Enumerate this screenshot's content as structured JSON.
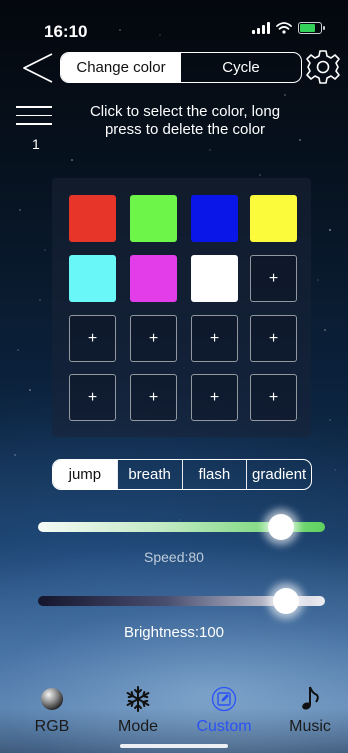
{
  "status": {
    "time": "16:10"
  },
  "header": {
    "tabs": [
      {
        "label": "Change color",
        "active": true
      },
      {
        "label": "Cycle",
        "active": false
      }
    ]
  },
  "list_count": "1",
  "hint": "Click to select the color, long press to delete the color",
  "grid": {
    "cells": [
      {
        "color": "#e8352a"
      },
      {
        "color": "#6df54a"
      },
      {
        "color": "#0a16e8"
      },
      {
        "color": "#fbfb3c"
      },
      {
        "color": "#6af7f7"
      },
      {
        "color": "#e23de8"
      },
      {
        "color": "#ffffff"
      },
      {
        "add": "+"
      },
      {
        "add": "+"
      },
      {
        "add": "+"
      },
      {
        "add": "+"
      },
      {
        "add": "+"
      },
      {
        "add": "+"
      },
      {
        "add": "+"
      },
      {
        "add": "+"
      },
      {
        "add": "+"
      }
    ]
  },
  "modes": [
    {
      "label": "jump",
      "active": true
    },
    {
      "label": "breath",
      "active": false
    },
    {
      "label": "flash",
      "active": false
    },
    {
      "label": "gradient",
      "active": false
    }
  ],
  "speed": {
    "label": "Speed:80",
    "value": 80
  },
  "brightness": {
    "label": "Brightness:100",
    "value": 100
  },
  "tabbar": [
    {
      "label": "RGB",
      "icon": "rgb-ball-icon",
      "active": false
    },
    {
      "label": "Mode",
      "icon": "snowflake-icon",
      "active": false
    },
    {
      "label": "Custom",
      "icon": "edit-icon",
      "active": true
    },
    {
      "label": "Music",
      "icon": "music-note-icon",
      "active": false
    }
  ],
  "colors": {
    "accent": "#2a52f5",
    "speed_track_end": "#5fd25f"
  }
}
